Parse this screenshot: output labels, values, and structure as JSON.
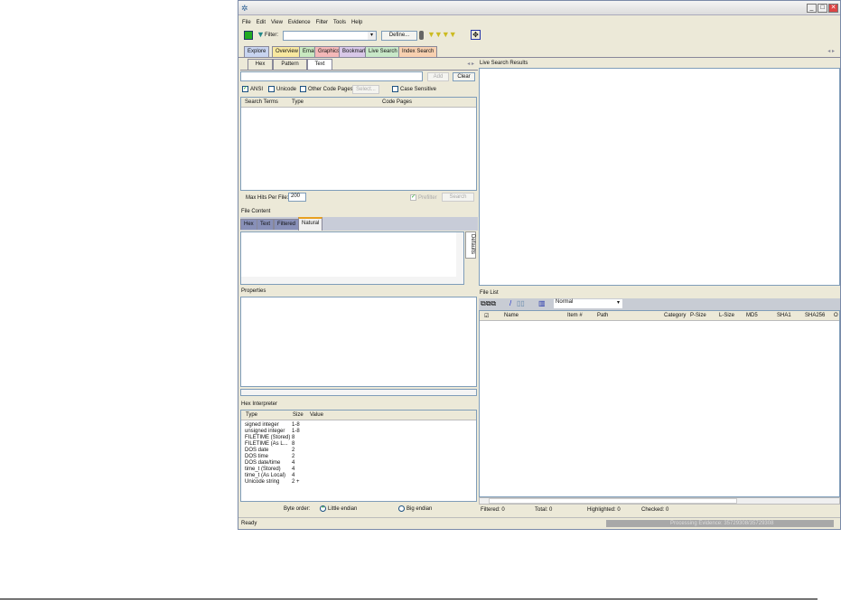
{
  "menu": [
    "File",
    "Edit",
    "View",
    "Evidence",
    "Filter",
    "Tools",
    "Help"
  ],
  "toolbar": {
    "filter_label": "Filter:",
    "filter_value": "",
    "define_label": "Define..."
  },
  "main_tabs": [
    {
      "label": "Explore",
      "color": "#c8d4f0"
    },
    {
      "label": "Overview",
      "color": "#f8e8a0"
    },
    {
      "label": "Email",
      "color": "#c8e8c0"
    },
    {
      "label": "Graphics",
      "color": "#f4b8b8"
    },
    {
      "label": "Bookmarks",
      "color": "#d8c8e8"
    },
    {
      "label": "Live Search",
      "color": "#c8e8c8"
    },
    {
      "label": "Index Search",
      "color": "#f8d0b0"
    }
  ],
  "search": {
    "sub_tabs": [
      "Hex",
      "Pattern",
      "Text"
    ],
    "input_value": "",
    "add_label": "Add",
    "clear_label": "Clear",
    "options": {
      "ansi": "ANSI",
      "unicode": "Unicode",
      "other": "Other Code Pages",
      "select": "Select...",
      "case": "Case Sensitive"
    },
    "columns": [
      "Search Terms",
      "Type",
      "Code Pages"
    ],
    "max_hits_label": "Max Hits Per File:",
    "max_hits_value": "200",
    "prefilter_label": "Prefilter",
    "search_label": "Search"
  },
  "file_content": {
    "title": "File Content",
    "tabs": [
      "Hex",
      "Text",
      "Filtered",
      "Natural"
    ],
    "side_tab": "Defaults"
  },
  "properties": {
    "title": "Properties"
  },
  "hex_interpreter": {
    "title": "Hex Interpreter",
    "columns": [
      "Type",
      "Size",
      "Value"
    ],
    "rows": [
      [
        "signed integer",
        "1-8"
      ],
      [
        "unsigned integer",
        "1-8"
      ],
      [
        "FILETIME (Stored)",
        "8"
      ],
      [
        "FILETIME (As L...",
        "8"
      ],
      [
        "DOS date",
        "2"
      ],
      [
        "DOS time",
        "2"
      ],
      [
        "DOS date/time",
        "4"
      ],
      [
        "time_t (Stored)",
        "4"
      ],
      [
        "time_t (As Local)",
        "4"
      ],
      [
        "Unicode string",
        "2 +"
      ]
    ],
    "byte_order_label": "Byte order:",
    "little": "Little endian",
    "big": "Big endian"
  },
  "live_search": {
    "title": "Live Search Results"
  },
  "file_list": {
    "title": "File List",
    "view": "Normal",
    "columns": [
      "Name",
      "Item #",
      "Path",
      "Category",
      "P-Size",
      "L-Size",
      "MD5",
      "SHA1",
      "SHA256",
      "O"
    ],
    "counts": {
      "filtered": "Filtered: 0",
      "total": "Total: 0",
      "highlighted": "Highlighted: 0",
      "checked": "Checked: 0"
    }
  },
  "status": {
    "text": "Ready",
    "progress_text": "Processing Evidence: 35729308/35729308",
    "progress": 1.0
  }
}
